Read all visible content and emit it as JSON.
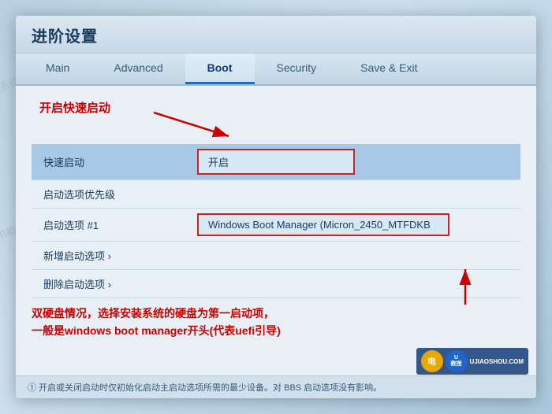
{
  "window": {
    "title": "进阶设置",
    "background_color": "#c8dce8"
  },
  "tabs": [
    {
      "id": "main",
      "label": "Main",
      "active": false
    },
    {
      "id": "advanced",
      "label": "Advanced",
      "active": false
    },
    {
      "id": "boot",
      "label": "Boot",
      "active": true
    },
    {
      "id": "security",
      "label": "Security",
      "active": false
    },
    {
      "id": "save_exit",
      "label": "Save & Exit",
      "active": false
    }
  ],
  "annotation_top": {
    "text": "开启快速启动"
  },
  "settings": [
    {
      "id": "fast_boot",
      "label": "快速启动",
      "value": "开启",
      "has_box": true,
      "highlighted": true
    },
    {
      "id": "boot_option_priority",
      "label": "启动选项优先级",
      "value": "",
      "has_box": false,
      "highlighted": false
    },
    {
      "id": "boot_option_1",
      "label": "启动选项 #1",
      "value": "Windows Boot Manager (Micron_2450_MTFDKB",
      "has_box": true,
      "highlighted": false
    },
    {
      "id": "add_boot_option",
      "label": "新增启动选项",
      "has_chevron": true,
      "has_box": false,
      "highlighted": false
    },
    {
      "id": "delete_boot_option",
      "label": "删除启动选项",
      "has_chevron": true,
      "has_box": false,
      "highlighted": false
    }
  ],
  "annotation_bottom": {
    "line1": "双硬盘情况，选择安装系统的硬盘为第一启动项，",
    "line2": "一般是windows boot manager开头(代表uefi引导)"
  },
  "info_bar": {
    "text": "① 开启或关闭启动时仅初始化启动主启动选项所需的最少设备。对 BBS 启动选项没有影响。"
  },
  "watermarks": [
    "电脑系统城www.dnxtc.net原创",
    "电脑系统城www.dnxtc.net原创",
    "电脑系统城www.dnxtc.net原创",
    "电脑系统城www.dnxtc.net原创"
  ],
  "corner_badges": {
    "left_label": "电",
    "center_label": "U教授",
    "site": "UJIAOSHOU.COM"
  }
}
